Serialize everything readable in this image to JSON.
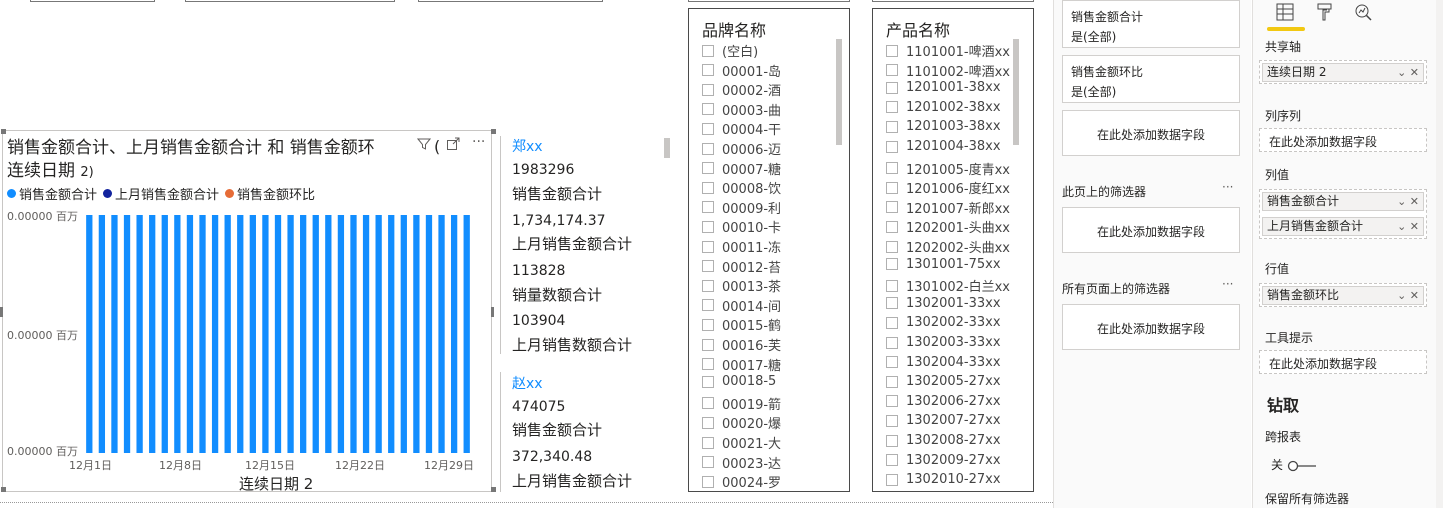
{
  "chart": {
    "title_line1": "销售金额合计、上月销售金额合计 和 销售金额环",
    "title_paren": "(",
    "title_line2": "连续日期",
    "title_line2_small": "2)",
    "icon_filter": "filter-icon",
    "icon_focus": "focus-mode-icon",
    "icon_more": "more-options-icon",
    "more_glyph": "···"
  },
  "chart_data": {
    "type": "bar",
    "title": "销售金额合计、上月销售金额合计 和 销售金额环(连续日期 2)",
    "xlabel": "连续日期 2",
    "ylabel": "",
    "series": [
      {
        "name": "销售金额合计",
        "color": "#118dff"
      },
      {
        "name": "上月销售金额合计",
        "color": "#12239e"
      },
      {
        "name": "销售金额环比",
        "color": "#e66c37"
      }
    ],
    "y_ticks": [
      "0.00000 百万",
      "0.00000 百万",
      "0.00000 百万"
    ],
    "x_ticks": [
      "12月1日",
      "12月8日",
      "12月15日",
      "12月22日",
      "12月29日"
    ],
    "bar_count": 31,
    "bar_value_fraction": 1.0
  },
  "cards": [
    {
      "name": "郑xx",
      "rows": [
        {
          "value": "1983296",
          "label": "销售金额合计"
        },
        {
          "value": "1,734,174.37",
          "label": "上月销售金额合计"
        },
        {
          "value": "113828",
          "label": "销量数额合计"
        },
        {
          "value": "103904",
          "label": "上月销售数额合计"
        }
      ]
    },
    {
      "name": "赵xx",
      "rows": [
        {
          "value": "474075",
          "label": "销售金额合计"
        },
        {
          "value": "372,340.48",
          "label": "上月销售金额合计"
        }
      ]
    }
  ],
  "slicer_brand": {
    "title": "品牌名称",
    "items": [
      "(空白)",
      "00001-岛",
      "00002-酒",
      "00003-曲",
      "00004-干",
      "00006-迈",
      "00007-糖",
      "00008-饮",
      "00009-利",
      "00010-卡",
      "00011-冻",
      "00012-苔",
      "00013-茶",
      "00014-间",
      "00015-鹤",
      "00016-芙",
      "00017-糖",
      "00018-5",
      "00019-箭",
      "00020-爆",
      "00021-大",
      "00023-达",
      "00024-罗"
    ]
  },
  "slicer_product": {
    "title": "产品名称",
    "items": [
      "1101001-啤酒xx",
      "1101002-啤酒xx",
      "1201001-38xx",
      "1201002-38xx",
      "1201003-38xx",
      "1201004-38xx",
      "1201005-度青xx",
      "1201006-度红xx",
      "1201007-新郎xx",
      "1202001-头曲xx",
      "1202002-头曲xx",
      "1301001-75xx",
      "1301002-白兰xx",
      "1302001-33xx",
      "1302002-33xx",
      "1302003-33xx",
      "1302004-33xx",
      "1302005-27xx",
      "1302006-27xx",
      "1302007-27xx",
      "1302008-27xx",
      "1302009-27xx",
      "1302010-27xx"
    ]
  },
  "filters": {
    "visual_filter_1": {
      "name": "销售金额合计",
      "state": "是(全部)"
    },
    "visual_filter_2": {
      "name": "销售金额环比",
      "state": "是(全部)"
    },
    "add_field": "在此处添加数据字段",
    "page_section": "此页上的筛选器",
    "all_pages_section": "所有页面上的筛选器",
    "more": "···"
  },
  "viz": {
    "tabs": [
      "fields-icon",
      "format-icon",
      "analytics-icon"
    ],
    "shared_axis_label": "共享轴",
    "shared_axis_field": "连续日期 2",
    "column_series_label": "列序列",
    "column_values_label": "列值",
    "column_value_1": "销售金额合计",
    "column_value_2": "上月销售金额合计",
    "line_values_label": "行值",
    "line_value_1": "销售金额环比",
    "tooltips_label": "工具提示",
    "add_field": "在此处添加数据字段",
    "drillthrough_title": "钻取",
    "cross_report_label": "跨报表",
    "toggle_state": "关",
    "keep_filters_label": "保留所有筛选器",
    "pill_controls": "⌄ ✕",
    "accent": "#f2c811"
  }
}
